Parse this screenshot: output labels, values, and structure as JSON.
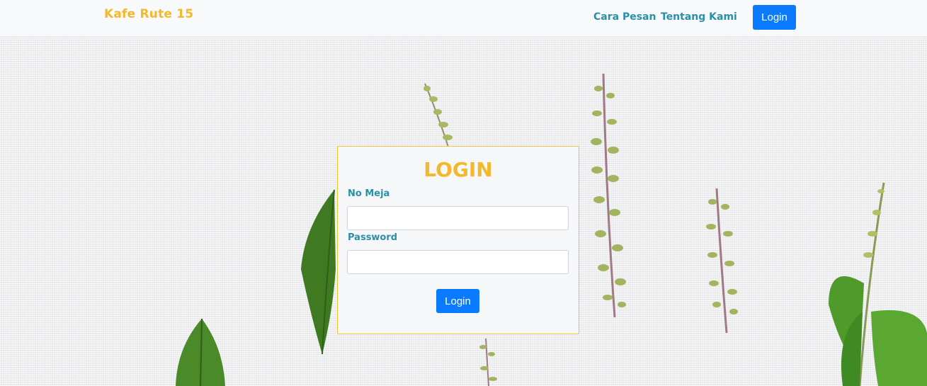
{
  "navbar": {
    "brand": "Kafe Rute 15",
    "links": [
      "Cara Pesan",
      "Tentang Kami"
    ],
    "login_label": "Login"
  },
  "login_form": {
    "title": "LOGIN",
    "table_label": "No Meja",
    "table_value": "",
    "password_label": "Password",
    "password_value": "",
    "submit_label": "Login"
  },
  "colors": {
    "brand": "#f4b92a",
    "link": "#2a8fa8",
    "button": "#0a7bff",
    "card_border": "#f1c234"
  },
  "background": "linen-with-basil-sprigs"
}
